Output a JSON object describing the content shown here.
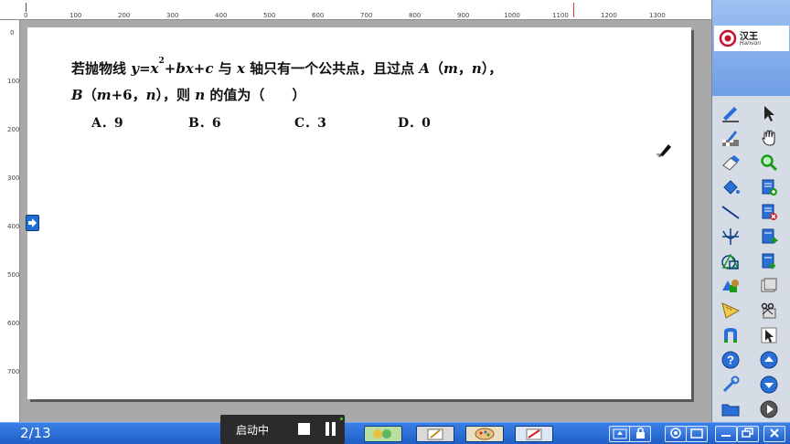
{
  "ruler": {
    "h_labels": [
      "0",
      "100",
      "200",
      "300",
      "400",
      "500",
      "600",
      "700",
      "800",
      "900",
      "1000",
      "1100",
      "1200",
      "1300"
    ],
    "v_labels": [
      "0",
      "100",
      "200",
      "300",
      "400",
      "500",
      "600",
      "700"
    ]
  },
  "question": {
    "prefix": "若抛物线 ",
    "eq_y": "y",
    "eq_eq": "=",
    "eq_x": "x",
    "eq_pow": "2",
    "eq_plus1": "+",
    "eq_bx": "bx",
    "eq_plus2": "+",
    "eq_c": "c",
    "mid1": " 与 ",
    "axis_x": "x",
    "mid2": " 轴只有一个公共点，且过点 ",
    "point_a": "A",
    "paren_a_open": "（",
    "a_m": "m",
    "a_comma": "，",
    "a_n": "n",
    "paren_a_close": "），",
    "point_b": "B",
    "paren_b_open": "（",
    "b_m": "m",
    "b_plus6": "+6，",
    "b_n": "n",
    "paren_b_close": "），则 ",
    "var_n": "n",
    "suffix": " 的值为（　　）"
  },
  "options": [
    {
      "label": "A．9"
    },
    {
      "label": "B．6"
    },
    {
      "label": "C．3"
    },
    {
      "label": "D．0"
    }
  ],
  "logo": {
    "name": "汉王",
    "sub": "Hanvon",
    "brand_color": "#c8102e"
  },
  "toolbar_icons": [
    "pen-icon",
    "select-arrow-icon",
    "brush-icon",
    "hand-icon",
    "eraser-icon",
    "zoom-icon",
    "fill-bucket-icon",
    "new-page-icon",
    "line-icon",
    "delete-page-icon",
    "compass-icon",
    "next-page-icon",
    "shapes-icon",
    "page-export-icon",
    "solids-icon",
    "screen-copy-icon",
    "ruler-icon",
    "cut-icon",
    "magnet-icon",
    "cursor-icon",
    "help-icon",
    "scroll-up-icon",
    "settings-icon",
    "scroll-down-icon",
    "folder-icon",
    "play-icon"
  ],
  "status": {
    "page_indicator": "2/13"
  },
  "recorder": {
    "label": "启动中"
  },
  "colors": {
    "accent": "#1e5fc8",
    "board": "#ffffff",
    "background": "#a9a9a9"
  }
}
